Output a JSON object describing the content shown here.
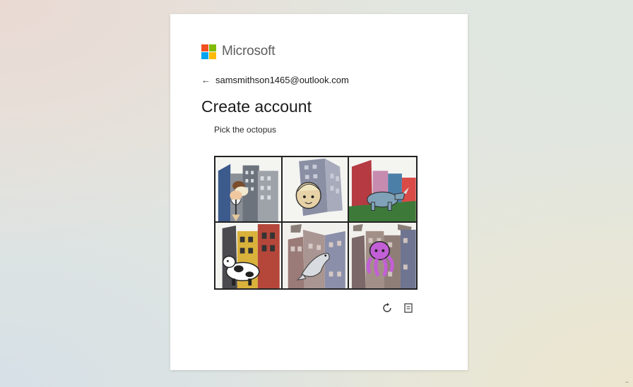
{
  "brand": {
    "name": "Microsoft",
    "logo_colors": [
      "#f25022",
      "#7fba00",
      "#00a4ef",
      "#ffb900"
    ]
  },
  "account": {
    "back_icon": "back-arrow-icon",
    "email": "samsmithson1465@outlook.com"
  },
  "page": {
    "title": "Create account",
    "instruction": "Pick the octopus"
  },
  "puzzle": {
    "tiles": [
      {
        "subject": "ice-cream"
      },
      {
        "subject": "face"
      },
      {
        "subject": "rhino"
      },
      {
        "subject": "cow"
      },
      {
        "subject": "seal"
      },
      {
        "subject": "octopus"
      }
    ]
  },
  "controls": {
    "refresh_icon": "refresh-icon",
    "audio_icon": "audio-icon"
  },
  "colors": {
    "card": "#ffffff",
    "text": "#1b1b1b",
    "octopus": "#c35fd6"
  }
}
